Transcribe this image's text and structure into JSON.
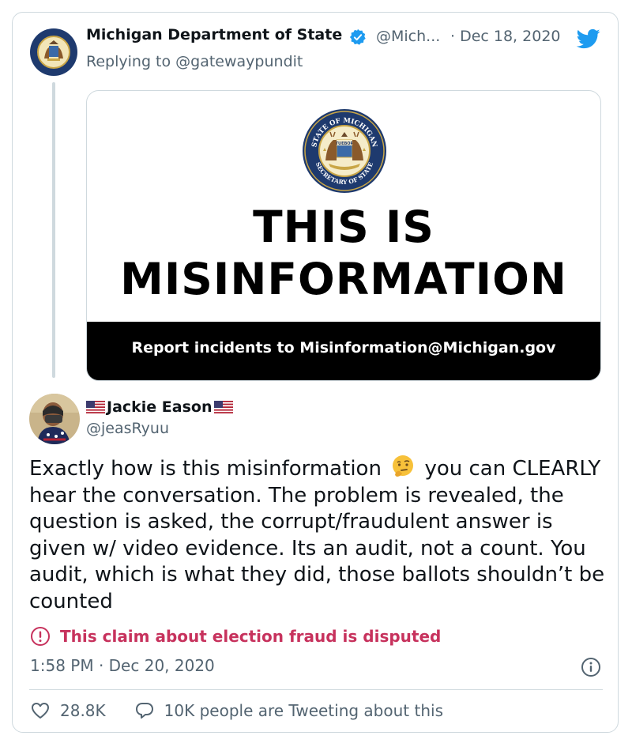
{
  "parent_tweet": {
    "author_name": "Michigan Department of State",
    "handle": "@Mich...",
    "date": "· Dec 18, 2020",
    "replying_to": "Replying to @gatewaypundit",
    "image": {
      "headline_line1": "THIS IS",
      "headline_line2": "MISINFORMATION",
      "banner_text": "Report incidents to Misinformation@Michigan.gov",
      "seal_outer_text": "STATE OF MICHIGAN",
      "seal_bottom_text": "SECRETARY OF STATE",
      "seal_motto": "TUEBOR"
    }
  },
  "reply_tweet": {
    "author_name": "Jackie Eason",
    "handle": "@jeasRyuu",
    "text_part1": "Exactly how is this misinformation",
    "emoji": "thinking-face-emoji",
    "text_part2": "you can CLEARLY hear the conversation. The problem is revealed, the question is asked, the corrupt/fraudulent answer is given w/ video evidence. Its an audit, not a count. You audit, which is what they did, those ballots shouldn’t be counted",
    "disputed_label": "This claim about election fraud is disputed",
    "timestamp": "1:58 PM · Dec 20, 2020",
    "likes": "28.8K",
    "conversation": "10K people are Tweeting about this"
  },
  "colors": {
    "twitter_blue": "#1d9bf0",
    "secondary_text": "#536471",
    "disputed_red": "#c7325d",
    "border": "#cfd9de"
  },
  "icons": [
    "verified-badge-icon",
    "twitter-bird-icon",
    "warning-circle-icon",
    "info-icon",
    "heart-icon",
    "reply-bubble-icon",
    "us-flag-icon"
  ]
}
